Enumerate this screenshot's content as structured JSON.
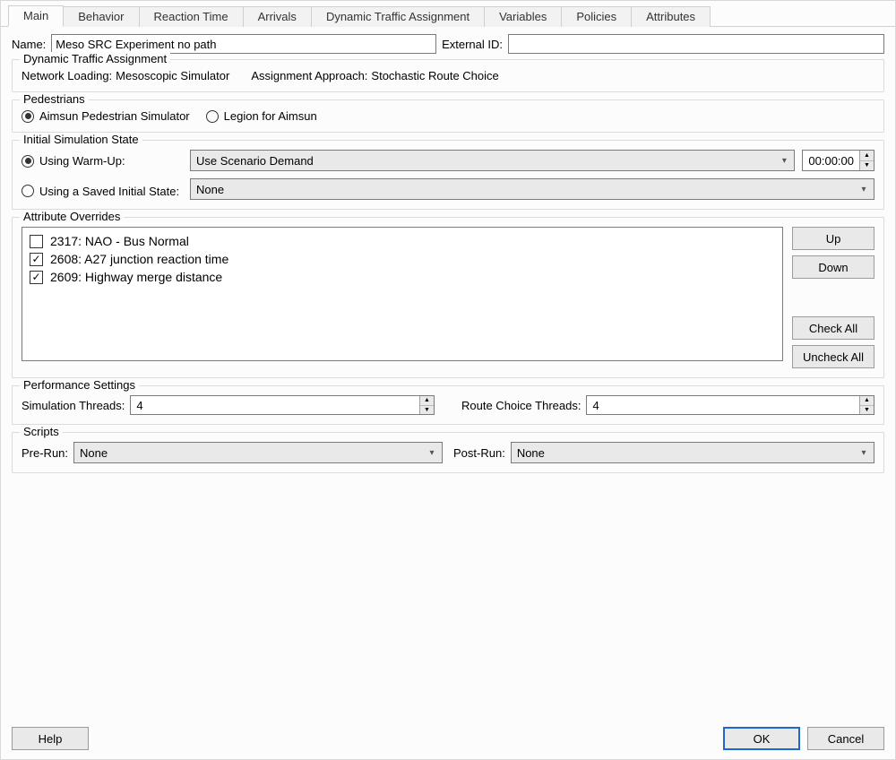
{
  "tabs": [
    "Main",
    "Behavior",
    "Reaction Time",
    "Arrivals",
    "Dynamic Traffic Assignment",
    "Variables",
    "Policies",
    "Attributes"
  ],
  "active_tab": "Main",
  "name_label": "Name:",
  "name_value": "Meso SRC Experiment no path",
  "external_id_label": "External ID:",
  "external_id_value": "",
  "dta": {
    "title": "Dynamic Traffic Assignment",
    "network_loading_label": "Network Loading:",
    "network_loading_value": "Mesoscopic Simulator",
    "assignment_label": "Assignment Approach:",
    "assignment_value": "Stochastic Route Choice"
  },
  "pedestrians": {
    "title": "Pedestrians",
    "options": [
      "Aimsun Pedestrian Simulator",
      "Legion for Aimsun"
    ],
    "selected": 0
  },
  "initial_state": {
    "title": "Initial Simulation State",
    "warmup_label": "Using Warm-Up:",
    "warmup_selected": true,
    "warmup_combo": "Use Scenario Demand",
    "warmup_time": "00:00:00",
    "saved_label": "Using a Saved Initial State:",
    "saved_combo": "None"
  },
  "overrides": {
    "title": "Attribute Overrides",
    "items": [
      {
        "checked": false,
        "label": "2317: NAO - Bus Normal"
      },
      {
        "checked": true,
        "label": "2608: A27 junction reaction time"
      },
      {
        "checked": true,
        "label": "2609: Highway merge distance"
      }
    ],
    "buttons": {
      "up": "Up",
      "down": "Down",
      "check_all": "Check All",
      "uncheck_all": "Uncheck All"
    }
  },
  "perf": {
    "title": "Performance Settings",
    "sim_threads_label": "Simulation Threads:",
    "sim_threads_value": "4",
    "route_threads_label": "Route Choice Threads:",
    "route_threads_value": "4"
  },
  "scripts": {
    "title": "Scripts",
    "prerun_label": "Pre-Run:",
    "prerun_value": "None",
    "postrun_label": "Post-Run:",
    "postrun_value": "None"
  },
  "footer": {
    "help": "Help",
    "ok": "OK",
    "cancel": "Cancel"
  }
}
